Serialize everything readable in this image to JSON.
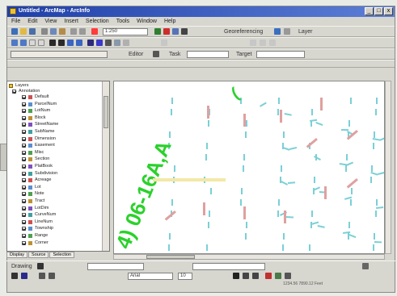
{
  "window": {
    "title": "Untitled - ArcMap - ArcInfo",
    "buttons": [
      "_",
      "□",
      "x"
    ]
  },
  "menubar": {
    "items": [
      "File",
      "Edit",
      "View",
      "Insert",
      "Selection",
      "Tools",
      "Window",
      "Help"
    ]
  },
  "toolbars": {
    "scale_value": "1:250",
    "georeferencing_label": "Georeferencing",
    "layer_label": "Layer",
    "editor_label": "Editor",
    "task_label": "Task",
    "target_label": "Target"
  },
  "toc": {
    "root_label": "Layers",
    "group_label": "Annotation",
    "layers": [
      "Default",
      "ParcelNum",
      "LotNum",
      "Block",
      "StreetName",
      "SubName",
      "Dimension",
      "Easement",
      "Misc",
      "Section",
      "PlatBook",
      "Subdivision",
      "Acreage",
      "Lot",
      "Note",
      "Tract",
      "LotDim",
      "CurveNum",
      "LineNum",
      "Township",
      "Range",
      "Corner"
    ],
    "tabs": [
      "Display",
      "Source",
      "Selection"
    ]
  },
  "map": {
    "big_label": "4) 06-16A,A",
    "big_label_color": "#2bd12b",
    "small_label_color": "#e0a0a0",
    "dim_label_color": "#7ad0d6"
  },
  "drawing_toolbar": {
    "drawing_label": "Drawing",
    "font_label": "Arial",
    "size_value": "10"
  },
  "status": {
    "text": "1234.56 7890.12 Feet"
  }
}
